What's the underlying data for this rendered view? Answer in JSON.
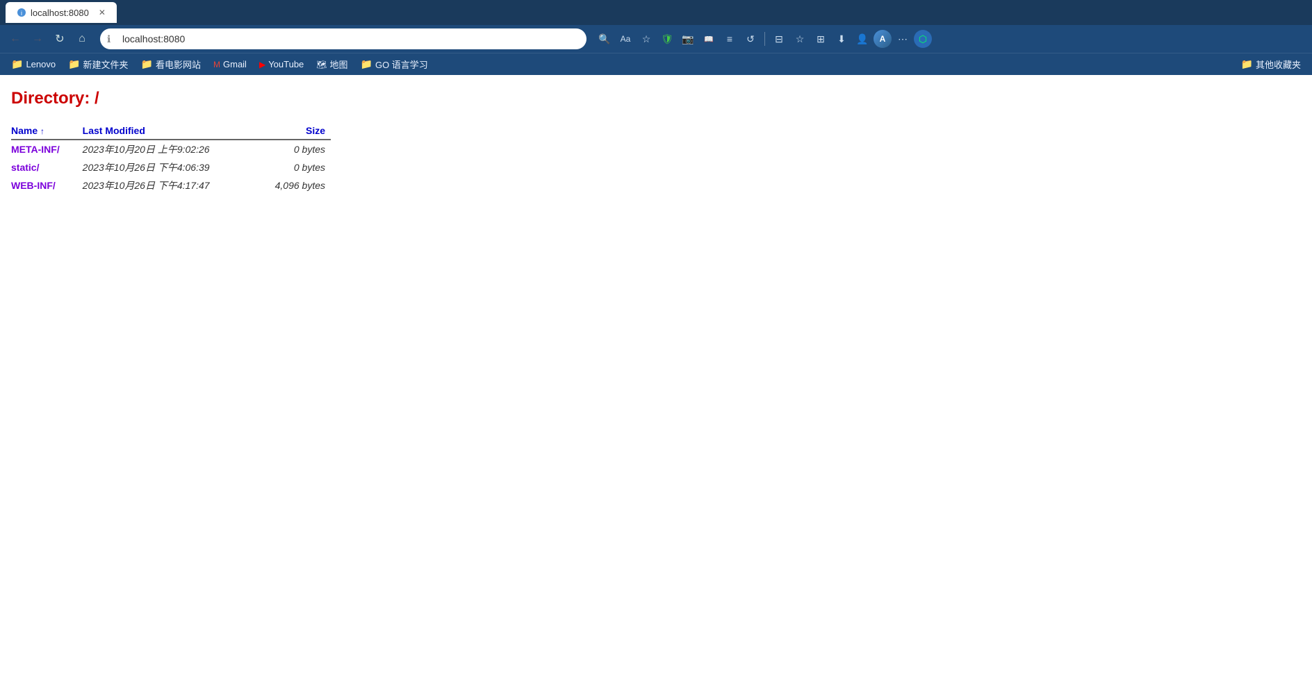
{
  "browser": {
    "tab": {
      "title": "localhost:8080",
      "favicon": "page-icon"
    },
    "addressBar": {
      "url": "localhost:8080",
      "securityIcon": "info-icon"
    },
    "bookmarks": [
      {
        "id": "lenovo",
        "label": "Lenovo",
        "type": "folder",
        "icon": "folder-icon"
      },
      {
        "id": "new-folder",
        "label": "新建文件夹",
        "type": "folder",
        "icon": "folder-icon"
      },
      {
        "id": "movie-site",
        "label": "看电影网站",
        "type": "folder",
        "icon": "folder-icon"
      },
      {
        "id": "gmail",
        "label": "Gmail",
        "type": "site",
        "icon": "gmail-icon"
      },
      {
        "id": "youtube",
        "label": "YouTube",
        "type": "site",
        "icon": "youtube-icon"
      },
      {
        "id": "maps",
        "label": "地图",
        "type": "site",
        "icon": "maps-icon"
      },
      {
        "id": "go-learn",
        "label": "GO 语言学习",
        "type": "folder",
        "icon": "folder-icon"
      },
      {
        "id": "other",
        "label": "其他收藏夹",
        "type": "folder",
        "icon": "folder-icon"
      }
    ]
  },
  "page": {
    "title": "Directory: /",
    "table": {
      "columns": {
        "name": "Name",
        "lastModified": "Last Modified",
        "size": "Size"
      },
      "rows": [
        {
          "name": "META-INF/",
          "lastModified": "2023年10月20日 上午9:02:26",
          "size": "0 bytes"
        },
        {
          "name": "static/",
          "lastModified": "2023年10月26日 下午4:06:39",
          "size": "0 bytes"
        },
        {
          "name": "WEB-INF/",
          "lastModified": "2023年10月26日 下午4:17:47",
          "size": "4,096 bytes"
        }
      ]
    }
  },
  "nav": {
    "back": "←",
    "forward": "→",
    "refresh": "↻",
    "home": "⌂",
    "more": "⋯"
  }
}
